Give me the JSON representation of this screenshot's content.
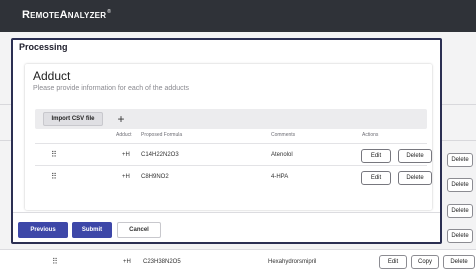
{
  "app": {
    "brand": "RemoteAnalyzer",
    "brand_mark": "®"
  },
  "background": {
    "side_buttons": [
      "Delete",
      "Delete",
      "Delete",
      "Delete"
    ],
    "row": {
      "adduct": "+H",
      "formula": "C23H38N2O5",
      "comment": "Hexahydrorsmipril",
      "edit": "Edit",
      "copy": "Copy",
      "delete": "Delete"
    }
  },
  "modal": {
    "title": "Processing",
    "card": {
      "title": "Adduct",
      "subtitle": "Please provide information for each of the adducts",
      "import_label": "Import CSV file",
      "add_label": "+",
      "columns": [
        "Adduct",
        "Proposed Formula",
        "Comments",
        "Actions"
      ],
      "rows": [
        {
          "adduct": "+H",
          "formula": "C14H22N2O3",
          "comment": "Atenolol",
          "edit": "Edit",
          "delete": "Delete"
        },
        {
          "adduct": "+H",
          "formula": "C8H9NO2",
          "comment": "4-HPA",
          "edit": "Edit",
          "delete": "Delete"
        }
      ]
    },
    "footer": {
      "previous": "Previous",
      "submit": "Submit",
      "cancel": "Cancel"
    }
  }
}
